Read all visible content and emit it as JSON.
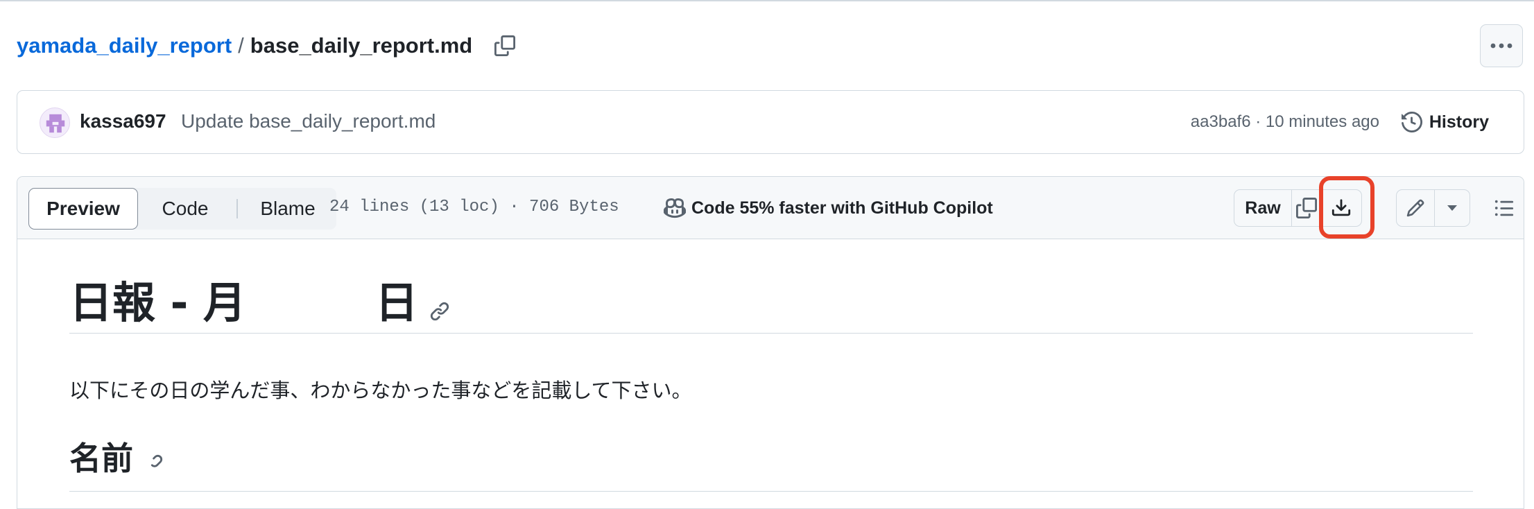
{
  "breadcrumb": {
    "repo": "yamada_daily_report",
    "separator": "/",
    "file": "base_daily_report.md"
  },
  "commit": {
    "author": "kassa697",
    "message": "Update base_daily_report.md",
    "sha_time": "aa3baf6 · 10 minutes ago",
    "history_label": "History"
  },
  "file_header": {
    "tabs": [
      "Preview",
      "Code",
      "Blame"
    ],
    "active_tab": "Preview",
    "meta": "24 lines (13 loc) · 706 Bytes",
    "copilot": "Code 55% faster with GitHub Copilot",
    "raw_label": "Raw"
  },
  "markdown": {
    "h1": "日報 - 月　　　日",
    "paragraph": "以下にその日の学んだ事、わからなかった事などを記載して下さい。",
    "h2": "名前"
  },
  "colors": {
    "link": "#0969da",
    "highlight": "#e8422a",
    "border": "#d1d9e0",
    "muted": "#59636e"
  },
  "icons": [
    "copy-icon",
    "kebab-icon",
    "history-icon",
    "copilot-icon",
    "copy-raw-icon",
    "download-icon",
    "pencil-icon",
    "caret-down-icon",
    "list-icon",
    "link-icon"
  ]
}
